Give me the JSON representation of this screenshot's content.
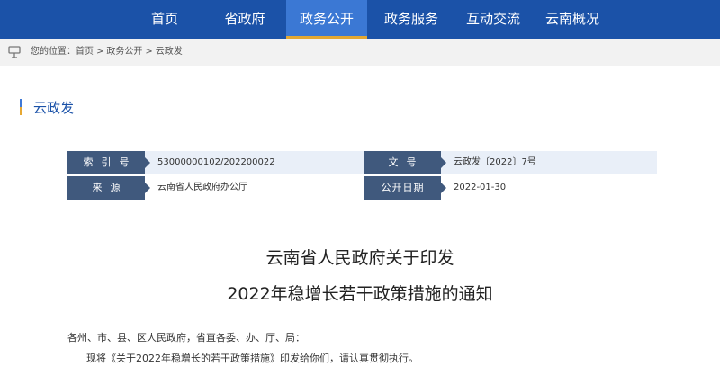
{
  "nav": {
    "items": [
      {
        "label": "首页"
      },
      {
        "label": "省政府"
      },
      {
        "label": "政务公开"
      },
      {
        "label": "政务服务"
      },
      {
        "label": "互动交流"
      },
      {
        "label": "云南概况"
      }
    ],
    "active_index": 2
  },
  "breadcrumb": {
    "prefix": "您的位置：",
    "items": [
      "首页",
      "政务公开",
      "云政发"
    ],
    "separator": ">"
  },
  "section": {
    "title": "云政发"
  },
  "meta": {
    "index_label": "索引号",
    "index_value": "53000000102/202200022",
    "docno_label": "文号",
    "docno_value": "云政发〔2022〕7号",
    "source_label": "来源",
    "source_value": "云南省人民政府办公厅",
    "date_label": "公开日期",
    "date_value": "2022-01-30"
  },
  "document": {
    "title_line1": "云南省人民政府关于印发",
    "title_line2": "2022年稳增长若干政策措施的通知",
    "salutation": "各州、市、县、区人民政府，省直各委、办、厅、局：",
    "para1": "现将《关于2022年稳增长的若干政策措施》印发给你们，请认真贯彻执行。"
  },
  "colors": {
    "nav_bg": "#1b52a8",
    "nav_active": "#3b78d4",
    "accent_gold": "#e3a833",
    "label_bg": "#40597d"
  }
}
